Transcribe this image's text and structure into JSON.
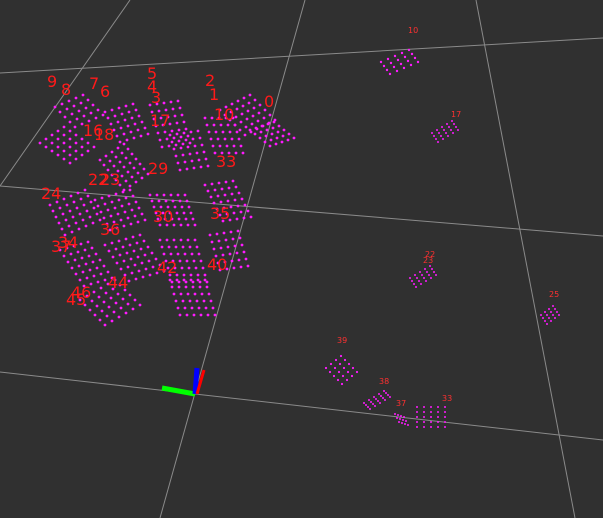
{
  "viewer": {
    "background": "#303030",
    "grid_color": "#9a9a9a",
    "marker_color": "#ff1aff",
    "label_color": "#ff1a1a"
  },
  "axes": {
    "x_color": "#ff0000",
    "y_color": "#00ff00",
    "z_color": "#0000ff"
  },
  "labels": {
    "l0": "0",
    "l1": "1",
    "l2": "2",
    "l3": "3",
    "l4": "4",
    "l5": "5",
    "l6": "6",
    "l7": "7",
    "l8": "8",
    "l9": "9",
    "l10": "10",
    "l16": "16",
    "l17": "17",
    "l18": "18",
    "l22": "22",
    "l23": "23",
    "l24": "24",
    "l29": "29",
    "l30": "30",
    "l33": "33",
    "l34": "34",
    "l35": "35",
    "l36": "36",
    "l37": "37",
    "l38": "38",
    "l39": "39",
    "l40": "40",
    "l41": "41",
    "l42": "42",
    "l43": "43",
    "l44": "44",
    "l45": "45",
    "l46": "46",
    "s10": "10",
    "s17": "17",
    "s22": "22",
    "s23": "23",
    "s25": "25",
    "s33": "33",
    "s37": "37",
    "s38": "38",
    "s39": "39"
  }
}
